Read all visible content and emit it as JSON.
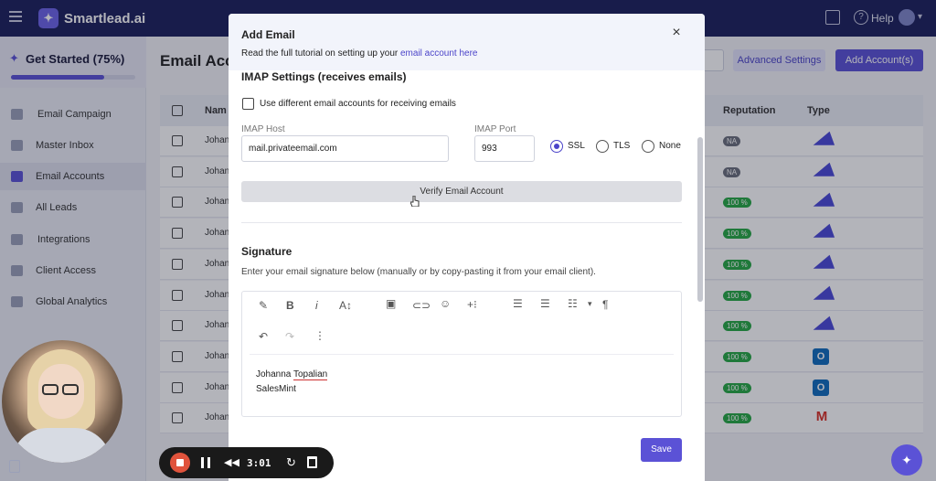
{
  "topbar": {
    "brand": "Smartlead.ai",
    "help": "Help",
    "icons": [
      "menu-icon",
      "gift-icon",
      "help-icon",
      "avatar",
      "chevron-down-icon"
    ]
  },
  "sidebar": {
    "get_started": "Get Started (75%)",
    "progress": 0.75,
    "items": [
      {
        "label": "Email Campaign",
        "icon": "campaign-icon"
      },
      {
        "label": "Master Inbox",
        "icon": "inbox-icon"
      },
      {
        "label": "Email Accounts",
        "icon": "mail-icon",
        "active": true
      },
      {
        "label": "All Leads",
        "icon": "leads-icon"
      },
      {
        "label": "Integrations",
        "icon": "integrations-icon"
      },
      {
        "label": "Client Access",
        "icon": "client-icon"
      },
      {
        "label": "Global Analytics",
        "icon": "analytics-icon"
      }
    ]
  },
  "main": {
    "title": "Email Acc",
    "advanced_settings": "Advanced Settings",
    "add_accounts": "Add Account(s)",
    "columns": {
      "name": "Nam",
      "reputation": "Reputation",
      "type": "Type"
    },
    "rows": [
      {
        "name": "Johan",
        "reputation": "NA",
        "type": "plane"
      },
      {
        "name": "Johan",
        "reputation": "NA",
        "type": "plane"
      },
      {
        "name": "Johan",
        "reputation": "100 %",
        "type": "plane"
      },
      {
        "name": "Johan",
        "reputation": "100 %",
        "type": "plane"
      },
      {
        "name": "Johan",
        "reputation": "100 %",
        "type": "plane"
      },
      {
        "name": "Johan",
        "reputation": "100 %",
        "type": "plane"
      },
      {
        "name": "Johan",
        "reputation": "100 %",
        "type": "plane"
      },
      {
        "name": "Johan",
        "reputation": "100 %",
        "type": "outlook"
      },
      {
        "name": "Johan",
        "reputation": "100 %",
        "type": "outlook"
      },
      {
        "name": "Johan",
        "reputation": "100 %",
        "type": "gmail"
      }
    ]
  },
  "modal": {
    "title": "Add Email",
    "subtitle_prefix": "Read the full tutorial on setting up your ",
    "subtitle_link": "email account here",
    "close": "×",
    "imap_title": "IMAP Settings (receives emails)",
    "diff_accounts": "Use different email accounts for receiving emails",
    "host_label": "IMAP Host",
    "host_value": "mail.privateemail.com",
    "port_label": "IMAP Port",
    "port_value": "993",
    "security": [
      {
        "label": "SSL",
        "selected": true
      },
      {
        "label": "TLS",
        "selected": false
      },
      {
        "label": "None",
        "selected": false
      }
    ],
    "verify": "Verify Email Account",
    "signature_title": "Signature",
    "signature_help": "Enter your email signature below (manually or by copy-pasting it from your email client).",
    "signature_lines": [
      "Johanna Topalian",
      "SalesMint"
    ],
    "toolbar": [
      "brush-icon",
      "bold-icon",
      "italic-icon",
      "font-size-icon",
      "image-icon",
      "link-icon",
      "emoji-icon",
      "insert-icon",
      "align-left-icon",
      "align-center-icon",
      "list-icon",
      "chevron-down-icon",
      "paragraph-icon",
      "undo-icon",
      "redo-icon",
      "more-icon"
    ],
    "toolbar_glyphs": {
      "bold": "B",
      "italic": "i",
      "font": "A↕",
      "paragraph": "¶",
      "more": "⋮"
    },
    "save": "Save"
  },
  "recorder": {
    "time": "3:01"
  }
}
